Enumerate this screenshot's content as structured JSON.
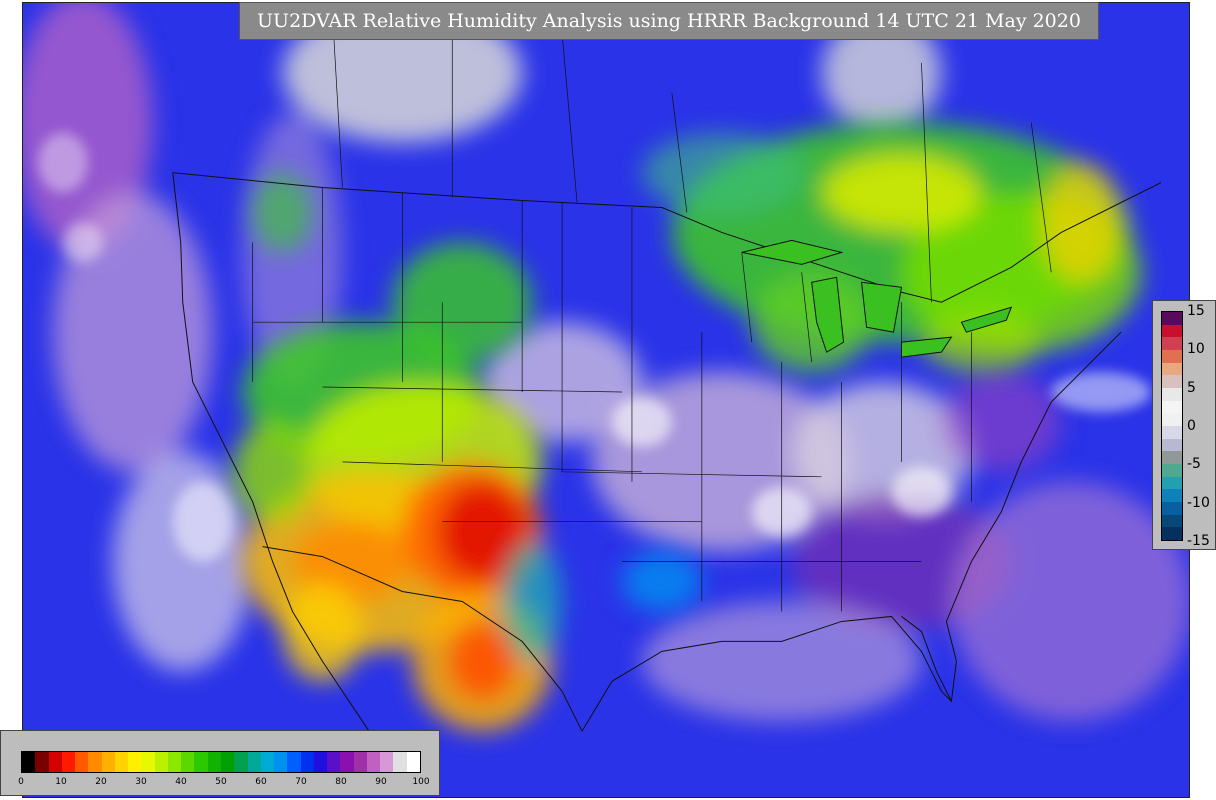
{
  "title": "UU2DVAR Relative Humidity Analysis using HRRR Background 14 UTC 21 May 2020",
  "rh_legend": {
    "ticks": [
      0,
      10,
      20,
      30,
      40,
      50,
      60,
      70,
      80,
      90,
      100
    ],
    "colors": [
      "#000000",
      "#7a0000",
      "#d40000",
      "#ff1a00",
      "#ff5a00",
      "#ff8c00",
      "#ffb000",
      "#ffd200",
      "#fff000",
      "#e8f800",
      "#bdf000",
      "#8ce800",
      "#5ad800",
      "#2cc800",
      "#10b400",
      "#00a000",
      "#00a050",
      "#00a89a",
      "#00aad4",
      "#0090f0",
      "#0060ff",
      "#0030f0",
      "#2010e0",
      "#5a10c8",
      "#8a10b0",
      "#a030a8",
      "#c060c0",
      "#d898d8",
      "#e0e0e0",
      "#ffffff"
    ],
    "range": [
      0,
      100
    ]
  },
  "increment_legend": {
    "ticks": [
      15,
      10,
      5,
      0,
      -5,
      -10,
      -15
    ],
    "colors": [
      "#5a0a5a",
      "#c8102e",
      "#d04050",
      "#e07050",
      "#e8a880",
      "#d8c0c0",
      "#e8e8e8",
      "#f4f4f4",
      "#f0f0f0",
      "#d8d8e8",
      "#b8b8d0",
      "#909898",
      "#50a890",
      "#20a0b0",
      "#1080b8",
      "#0860a0",
      "#064878",
      "#043060"
    ],
    "range": [
      -15,
      15
    ]
  }
}
